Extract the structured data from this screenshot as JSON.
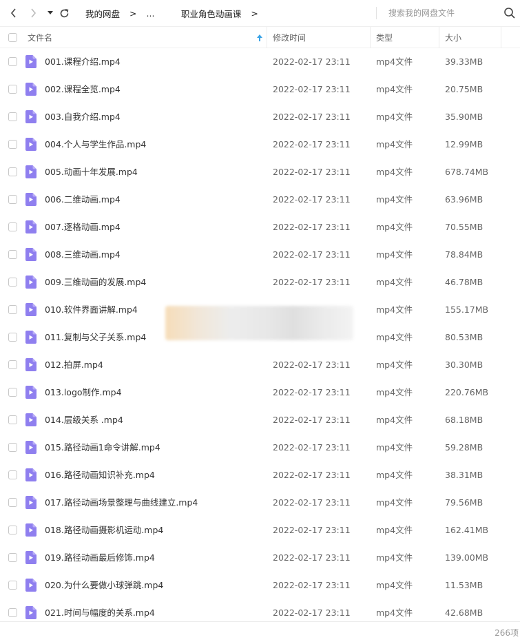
{
  "toolbar": {
    "breadcrumb": [
      "我的网盘",
      "...",
      "职业角色动画课"
    ],
    "separator": ">",
    "search_placeholder": "搜索我的网盘文件"
  },
  "columns": {
    "name": "文件名",
    "modified": "修改时间",
    "type": "类型",
    "size": "大小"
  },
  "files": [
    {
      "name": "001.课程介绍.mp4",
      "date": "2022-02-17 23:11",
      "type": "mp4文件",
      "size": "39.33MB"
    },
    {
      "name": "002.课程全览.mp4",
      "date": "2022-02-17 23:11",
      "type": "mp4文件",
      "size": "20.75MB"
    },
    {
      "name": "003.自我介绍.mp4",
      "date": "2022-02-17 23:11",
      "type": "mp4文件",
      "size": "35.90MB"
    },
    {
      "name": "004.个人与学生作品.mp4",
      "date": "2022-02-17 23:11",
      "type": "mp4文件",
      "size": "12.99MB"
    },
    {
      "name": "005.动画十年发展.mp4",
      "date": "2022-02-17 23:11",
      "type": "mp4文件",
      "size": "678.74MB"
    },
    {
      "name": "006.二维动画.mp4",
      "date": "2022-02-17 23:11",
      "type": "mp4文件",
      "size": "63.96MB"
    },
    {
      "name": "007.逐格动画.mp4",
      "date": "2022-02-17 23:11",
      "type": "mp4文件",
      "size": "70.55MB"
    },
    {
      "name": "008.三维动画.mp4",
      "date": "2022-02-17 23:11",
      "type": "mp4文件",
      "size": "78.84MB"
    },
    {
      "name": "009.三维动画的发展.mp4",
      "date": "2022-02-17 23:11",
      "type": "mp4文件",
      "size": "46.78MB"
    },
    {
      "name": "010.软件界面讲解.mp4",
      "date": "",
      "type": "mp4文件",
      "size": "155.17MB"
    },
    {
      "name": "011.复制与父子关系.mp4",
      "date": "",
      "type": "mp4文件",
      "size": "80.53MB"
    },
    {
      "name": "012.拍屏.mp4",
      "date": "2022-02-17 23:11",
      "type": "mp4文件",
      "size": "30.30MB"
    },
    {
      "name": "013.logo制作.mp4",
      "date": "2022-02-17 23:11",
      "type": "mp4文件",
      "size": "220.76MB"
    },
    {
      "name": "014.层级关系 .mp4",
      "date": "2022-02-17 23:11",
      "type": "mp4文件",
      "size": "68.18MB"
    },
    {
      "name": "015.路径动画1命令讲解.mp4",
      "date": "2022-02-17 23:11",
      "type": "mp4文件",
      "size": "59.28MB"
    },
    {
      "name": "016.路径动画知识补充.mp4",
      "date": "2022-02-17 23:11",
      "type": "mp4文件",
      "size": "38.31MB"
    },
    {
      "name": "017.路径动画场景整理与曲线建立.mp4",
      "date": "2022-02-17 23:11",
      "type": "mp4文件",
      "size": "79.56MB"
    },
    {
      "name": "018.路径动画摄影机运动.mp4",
      "date": "2022-02-17 23:11",
      "type": "mp4文件",
      "size": "162.41MB"
    },
    {
      "name": "019.路径动画最后修饰.mp4",
      "date": "2022-02-17 23:11",
      "type": "mp4文件",
      "size": "139.00MB"
    },
    {
      "name": "020.为什么要做小球弹跳.mp4",
      "date": "2022-02-17 23:11",
      "type": "mp4文件",
      "size": "11.53MB"
    },
    {
      "name": "021.时间与幅度的关系.mp4",
      "date": "2022-02-17 23:11",
      "type": "mp4文件",
      "size": "42.68MB"
    }
  ],
  "footer": {
    "count": "266项"
  },
  "colors": {
    "file_icon": "#8f7fef",
    "sort_arrow": "#3aa3e6"
  },
  "icons": {
    "back": "chevron-left-icon",
    "forward": "chevron-right-icon",
    "history": "caret-down-icon",
    "refresh": "refresh-icon",
    "search": "search-icon",
    "sort": "sort-up-icon",
    "file": "video-file-icon"
  }
}
